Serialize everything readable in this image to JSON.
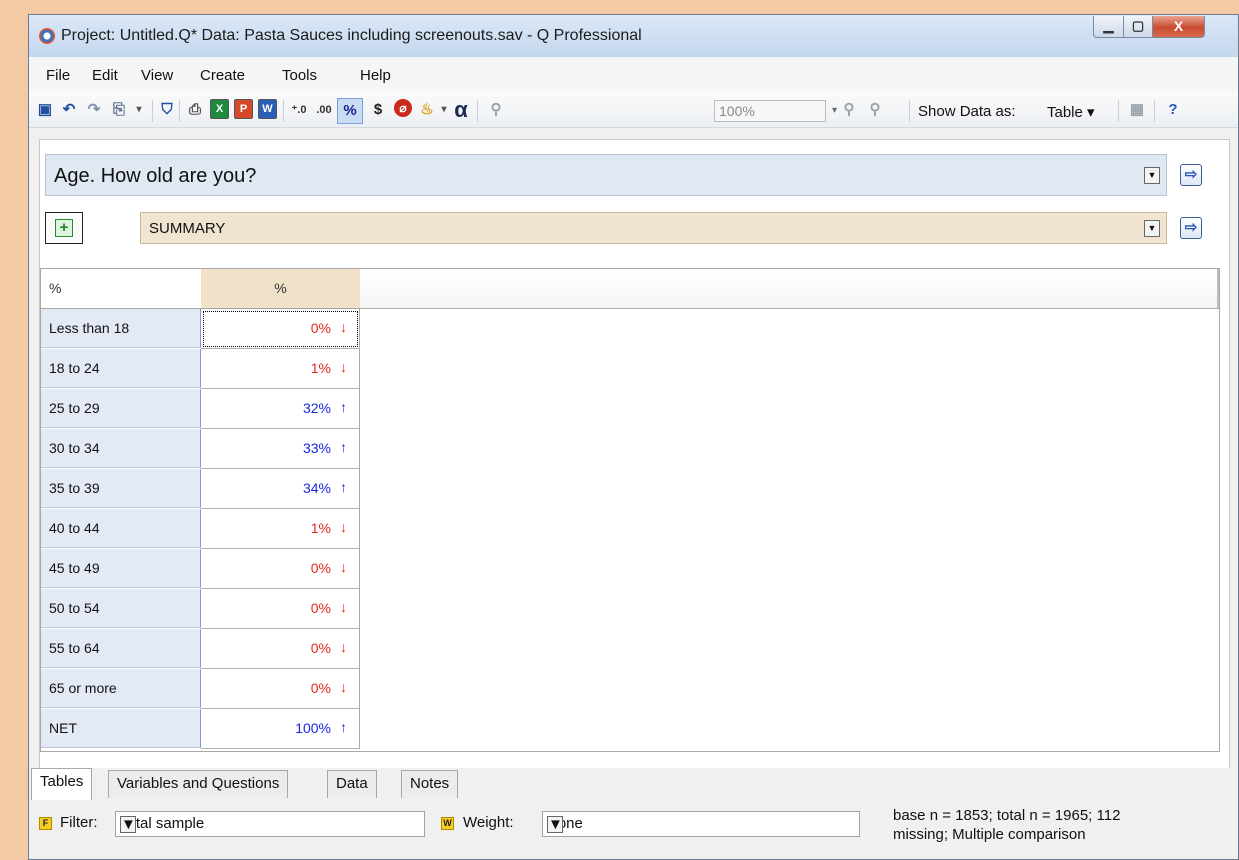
{
  "window": {
    "title": "Project: Untitled.Q*  Data: Pasta Sauces including screenouts.sav - Q Professional",
    "minimize_glyph": "▁",
    "maximize_glyph": "▢",
    "close_glyph": "X"
  },
  "menu": {
    "items": [
      {
        "label": "File"
      },
      {
        "label": "Edit"
      },
      {
        "label": "View"
      },
      {
        "label": "Create"
      },
      {
        "label": "Tools"
      },
      {
        "label": "Help"
      }
    ]
  },
  "toolbar": {
    "icons": [
      "save-icon",
      "undo-icon",
      "redo-icon",
      "copy-icon",
      "filter-icon",
      "print-icon",
      "excel-icon",
      "powerpoint-icon",
      "word-icon",
      "increase-decimals-icon",
      "decrease-decimals-icon",
      "percent-icon",
      "dollar-icon",
      "stop-icon",
      "palette-icon",
      "alpha-icon",
      "zoom-out-icon",
      "zoom-in-icon",
      "zoom-reset-icon",
      "chart-icon",
      "help-icon"
    ],
    "zoom_value": "100%",
    "percent_label": "%",
    "dollar_label": "$",
    "alpha_label": "α",
    "show_data_label": "Show Data as:",
    "show_data_value": "Table ▾",
    "excel_letter": "X",
    "powerpoint_letter": "P",
    "word_letter": "W",
    "inc_decimals": "⁺.0",
    "dec_decimals": ".00",
    "accent": "#2b57b8"
  },
  "question": {
    "value": "Age. How old are you?"
  },
  "banner": {
    "value": "SUMMARY"
  },
  "table": {
    "corner_header": "%",
    "column_header": "%",
    "rows": [
      {
        "label": "Less than 18",
        "value": "0%",
        "arrow": "↓",
        "direction": "down"
      },
      {
        "label": "18 to 24",
        "value": "1%",
        "arrow": "↓",
        "direction": "down"
      },
      {
        "label": "25 to 29",
        "value": "32%",
        "arrow": "↑",
        "direction": "up"
      },
      {
        "label": "30 to 34",
        "value": "33%",
        "arrow": "↑",
        "direction": "up"
      },
      {
        "label": "35 to 39",
        "value": "34%",
        "arrow": "↑",
        "direction": "up"
      },
      {
        "label": "40 to 44",
        "value": "1%",
        "arrow": "↓",
        "direction": "down"
      },
      {
        "label": "45 to 49",
        "value": "0%",
        "arrow": "↓",
        "direction": "down"
      },
      {
        "label": "50 to 54",
        "value": "0%",
        "arrow": "↓",
        "direction": "down"
      },
      {
        "label": "55 to 64",
        "value": "0%",
        "arrow": "↓",
        "direction": "down"
      },
      {
        "label": "65 or more",
        "value": "0%",
        "arrow": "↓",
        "direction": "down"
      },
      {
        "label": "NET",
        "value": "100%",
        "arrow": "↑",
        "direction": "up"
      }
    ],
    "up_color": "#1826e6",
    "down_color": "#e8261b"
  },
  "tabs": [
    {
      "label": "Tables",
      "active": true
    },
    {
      "label": "Variables and Questions",
      "active": false
    },
    {
      "label": "Data",
      "active": false
    },
    {
      "label": "Notes",
      "active": false
    }
  ],
  "bottom": {
    "filter_badge": "F",
    "filter_label": "Filter:",
    "filter_value": "Total sample",
    "weight_badge": "W",
    "weight_label": "Weight:",
    "weight_value": "None",
    "stats_line1": "base n = 1853; total n = 1965; 112",
    "stats_line2": "missing; Multiple comparison"
  }
}
